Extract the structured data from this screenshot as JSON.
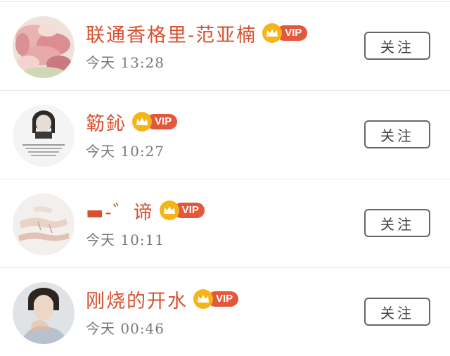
{
  "colors": {
    "name": "#d9502f",
    "vip_pill": "#e3573c",
    "vip_crown": "#f6b417",
    "time": "#777777",
    "button_border": "#666666"
  },
  "vip_label": "VIP",
  "follow_label": "关注",
  "users": [
    {
      "name": "联通香格里-范亚楠",
      "time": "今天 13:28",
      "avatar": "pink-flower-petals-image"
    },
    {
      "name": "簕鈊",
      "time": "今天 10:27",
      "avatar": "girl-portrait-with-text-image"
    },
    {
      "name": "▬-゛谛",
      "time": "今天 10:11",
      "avatar": "hands-illustration-image"
    },
    {
      "name": "刚烧的开水",
      "time": "今天 00:46",
      "avatar": "young-man-portrait-image"
    }
  ]
}
